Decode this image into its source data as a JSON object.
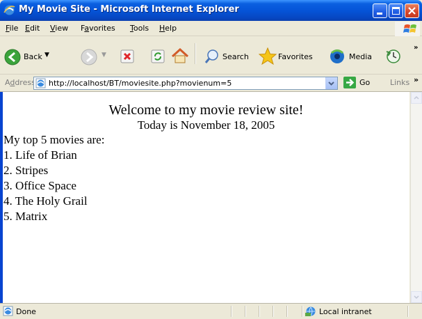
{
  "window": {
    "title": "My Movie Site - Microsoft Internet Explorer"
  },
  "menu": {
    "items": [
      {
        "label_u": "F",
        "label_rest": "ile"
      },
      {
        "label_u": "E",
        "label_rest": "dit"
      },
      {
        "label_u": "V",
        "label_rest": "iew"
      },
      {
        "label_pre": "F",
        "label_u": "a",
        "label_rest": "vorites"
      },
      {
        "label_u": "T",
        "label_rest": "ools"
      },
      {
        "label_u": "H",
        "label_rest": "elp"
      }
    ]
  },
  "toolbar": {
    "back_label": "Back",
    "search_label": "Search",
    "favorites_label": "Favorites",
    "media_label": "Media"
  },
  "address": {
    "label_pre": "A",
    "label_u": "d",
    "label_rest": "dress",
    "url": "http://localhost/BT/moviesite.php?movienum=5",
    "go_label": "Go",
    "links_label": "Links"
  },
  "page": {
    "heading": "Welcome to my movie review site!",
    "date_line": "Today is November 18, 2005",
    "intro": "My top 5 movies are:",
    "movies": [
      "1. Life of Brian",
      "2. Stripes",
      "3. Office Space",
      "4. The Holy Grail",
      "5. Matrix"
    ]
  },
  "status": {
    "text": "Done",
    "zone": "Local intranet"
  },
  "colors": {
    "titlebar": "#0554d8",
    "chrome": "#ece9d8",
    "content_bg": "#ffffff"
  }
}
